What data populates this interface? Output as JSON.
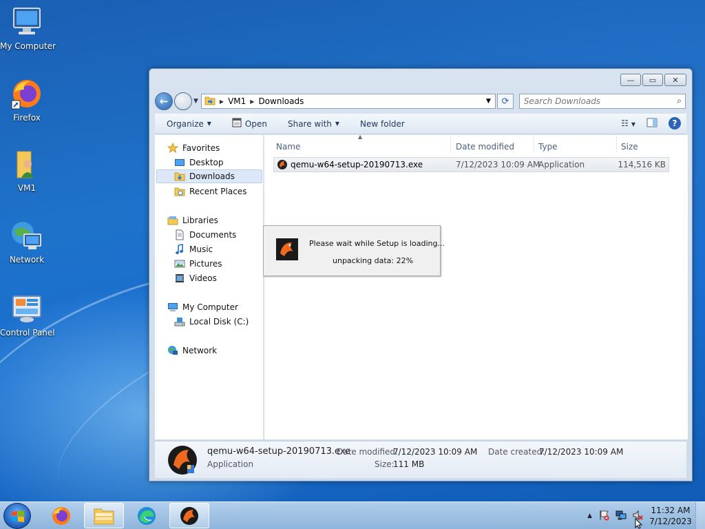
{
  "desktop": {
    "icons": [
      {
        "label": "My Computer"
      },
      {
        "label": "Firefox"
      },
      {
        "label": "VM1"
      },
      {
        "label": "Network"
      },
      {
        "label": "Control Panel"
      }
    ]
  },
  "window": {
    "breadcrumb": [
      "VM1",
      "Downloads"
    ],
    "search_placeholder": "Search Downloads",
    "toolbar": {
      "organize": "Organize",
      "open": "Open",
      "share_with": "Share with",
      "new_folder": "New folder"
    },
    "nav": {
      "favorites": "Favorites",
      "desktop": "Desktop",
      "downloads": "Downloads",
      "recent_places": "Recent Places",
      "libraries": "Libraries",
      "documents": "Documents",
      "music": "Music",
      "pictures": "Pictures",
      "videos": "Videos",
      "my_computer": "My Computer",
      "local_disk": "Local Disk (C:)",
      "network": "Network"
    },
    "columns": {
      "name": "Name",
      "date_modified": "Date modified",
      "type": "Type",
      "size": "Size"
    },
    "files": [
      {
        "name": "qemu-w64-setup-20190713.exe",
        "date_modified": "7/12/2023 10:09 AM",
        "type": "Application",
        "size": "114,516 KB"
      }
    ],
    "details": {
      "filename": "qemu-w64-setup-20190713.exe",
      "filetype": "Application",
      "date_modified_label": "Date modified:",
      "date_modified": "7/12/2023 10:09 AM",
      "date_created_label": "Date created:",
      "date_created": "7/12/2023 10:09 AM",
      "size_label": "Size:",
      "size": "111 MB"
    }
  },
  "setup_dialog": {
    "message": "Please wait while Setup is loading...",
    "progress": "unpacking data: 22%"
  },
  "taskbar": {
    "clock_time": "11:32 AM",
    "clock_date": "7/12/2023"
  },
  "colors": {
    "accent": "#1e72c9",
    "selection": "#dce8f7"
  }
}
